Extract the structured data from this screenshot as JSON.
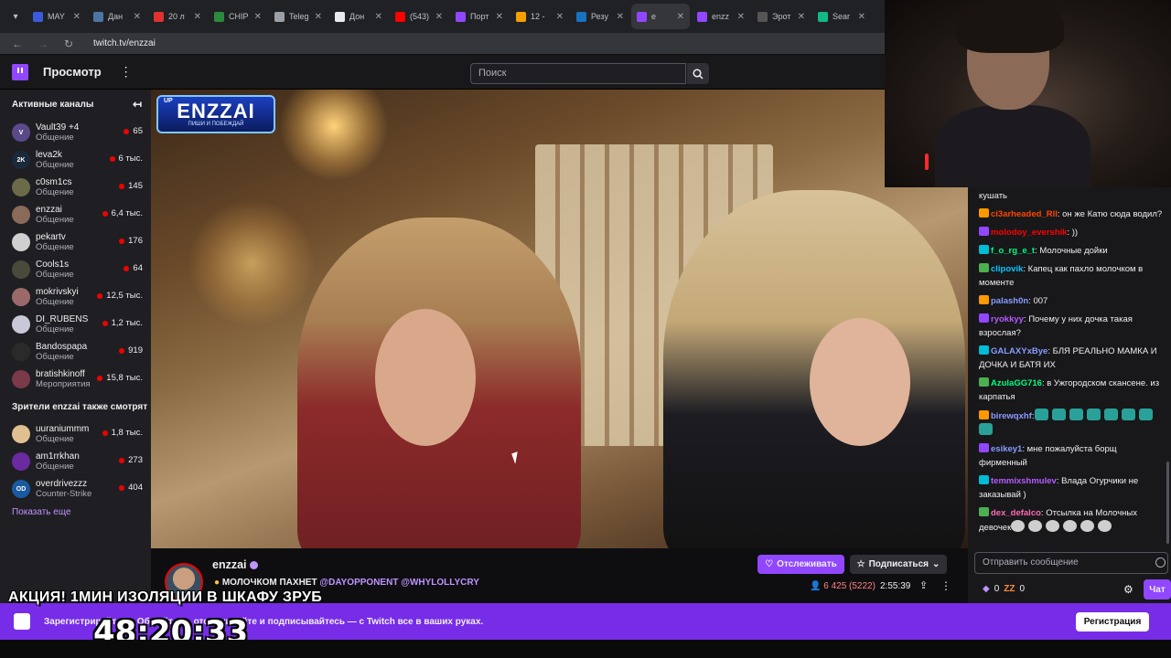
{
  "browser": {
    "tabs": [
      {
        "label": "MAY",
        "color": "#3b5bdb"
      },
      {
        "label": "Дан",
        "color": "#4c75a3"
      },
      {
        "label": "20 л",
        "color": "#e03131"
      },
      {
        "label": "CHIP",
        "color": "#2b8a3e"
      },
      {
        "label": "Teleg",
        "color": "#9aa0a6"
      },
      {
        "label": "Дон",
        "color": "#e8eaed"
      },
      {
        "label": "(543)",
        "color": "#ff0000"
      },
      {
        "label": "Порт",
        "color": "#9147ff"
      },
      {
        "label": "12 -",
        "color": "#f59f00"
      },
      {
        "label": "Резу",
        "color": "#1971c2"
      },
      {
        "label": "e",
        "color": "#9147ff"
      },
      {
        "label": "enzz",
        "color": "#9147ff"
      },
      {
        "label": "Эрот",
        "color": "#555"
      },
      {
        "label": "Sear",
        "color": "#12b886"
      }
    ],
    "url": "twitch.tv/enzzai"
  },
  "nav": {
    "browse": "Просмотр",
    "search_placeholder": "Поиск"
  },
  "sidebar": {
    "active_title": "Активные каналы",
    "channels": [
      {
        "name": "Vault39 +4",
        "cat": "Общение",
        "viewers": "65",
        "color": "#5a4a8a",
        "initials": "V"
      },
      {
        "name": "leva2k",
        "cat": "Общение",
        "viewers": "6 тыс.",
        "color": "#1b2a3a",
        "initials": "2K"
      },
      {
        "name": "c0sm1cs",
        "cat": "Общение",
        "viewers": "145",
        "color": "#6b6b4a",
        "initials": ""
      },
      {
        "name": "enzzai",
        "cat": "Общение",
        "viewers": "6,4 тыс.",
        "color": "#8a6a58",
        "initials": ""
      },
      {
        "name": "pekartv",
        "cat": "Общение",
        "viewers": "176",
        "color": "#d0d0d0",
        "initials": ""
      },
      {
        "name": "Cools1s",
        "cat": "Общение",
        "viewers": "64",
        "color": "#4a4a3a",
        "initials": ""
      },
      {
        "name": "mokrivskyi",
        "cat": "Общение",
        "viewers": "12,5 тыс.",
        "color": "#9a6a6a",
        "initials": ""
      },
      {
        "name": "DI_RUBENS",
        "cat": "Общение",
        "viewers": "1,2 тыс.",
        "color": "#c8c8d8",
        "initials": ""
      },
      {
        "name": "Bandospapa",
        "cat": "Общение",
        "viewers": "919",
        "color": "#2a2a2a",
        "initials": ""
      },
      {
        "name": "bratishkinoff",
        "cat": "Мероприятия",
        "viewers": "15,8 тыс.",
        "color": "#7a3a4a",
        "initials": ""
      }
    ],
    "also_title": "Зрители enzzai также смотрят",
    "also": [
      {
        "name": "uuraniummm",
        "cat": "Общение",
        "viewers": "1,8 тыс.",
        "color": "#e0c090",
        "initials": ""
      },
      {
        "name": "am1rrkhan",
        "cat": "Общение",
        "viewers": "273",
        "color": "#6a2aa0",
        "initials": ""
      },
      {
        "name": "overdrivezzz",
        "cat": "Counter-Strike",
        "viewers": "404",
        "color": "#1a5aa0",
        "initials": "OD"
      }
    ],
    "show_more": "Показать еще"
  },
  "video": {
    "overlay_up": "UP",
    "overlay_big": "ENZZAI",
    "overlay_small": "ПИШИ И ПОБЕЖДАЙ"
  },
  "chat": {
    "messages": [
      {
        "user": "",
        "color": "#efeff1",
        "text": "кушать"
      },
      {
        "user": "ci3arheaded_Rll",
        "color": "#ff4500",
        "text": ": он же Катю сюда водил?"
      },
      {
        "user": "molodoy_evershik",
        "color": "#ff0000",
        "text": ": ))"
      },
      {
        "user": "f_o_rg_e_t",
        "color": "#00ff7f",
        "text": ": Молочные дойки"
      },
      {
        "user": "clipovik",
        "color": "#00c8ff",
        "text": ": Капец как пахло молочком в моменте"
      },
      {
        "user": "palash0n",
        "color": "#8a9bff",
        "text": ": 007"
      },
      {
        "user": "ryokkyy",
        "color": "#b55bff",
        "text": ": Почему у них дочка такая взрослая?"
      },
      {
        "user": "GALAXYxBye",
        "color": "#8a9bff",
        "text": ": БЛЯ РЕАЛЬНО МАМКА И ДОЧКА И БАТЯ ИХ"
      },
      {
        "user": "AzulaGG716",
        "color": "#00ff7f",
        "text": ": в Ужгородском скансене. из карпатья"
      },
      {
        "user": "birewqxhf",
        "color": "#8a9bff",
        "text": ":"
      },
      {
        "user": "esikey1",
        "color": "#8a9bff",
        "text": ": мне пожалуйста борщ фирменный"
      },
      {
        "user": "temmixshmulev",
        "color": "#b55bff",
        "text": ": Влада Огурчики не заказывай )"
      },
      {
        "user": "dex_defalco",
        "color": "#ff69b4",
        "text": ": Отсылка на Молочных девочек"
      }
    ],
    "input_placeholder": "Отправить сообщение",
    "points": "0",
    "points2": "0",
    "chat_button": "Чат"
  },
  "stream": {
    "name": "enzzai",
    "title_prefix": "МОЛОЧКОМ ПАХНЕТ ",
    "mention1": "@DAYOPPONENT",
    "mention2": "@WHYLOLLYCRY",
    "follow": "Отслеживать",
    "subscribe": "Подписаться",
    "viewers": "6 425 (5222)",
    "uptime": "2:55:39"
  },
  "promo_text": "АКЦИЯ! 1МИН ИЗОЛЯЦИИ В ШКАФУ ЗРУБ",
  "banner": {
    "text": "Зарегистрируйтесь. Общайтесь, отслеживайте и подписывайтесь — с Twitch все в ваших руках.",
    "button": "Регистрация"
  },
  "timer": "48:20:33",
  "colors": {
    "accent": "#9147ff",
    "live": "#eb0400",
    "banner": "#772ce8"
  }
}
